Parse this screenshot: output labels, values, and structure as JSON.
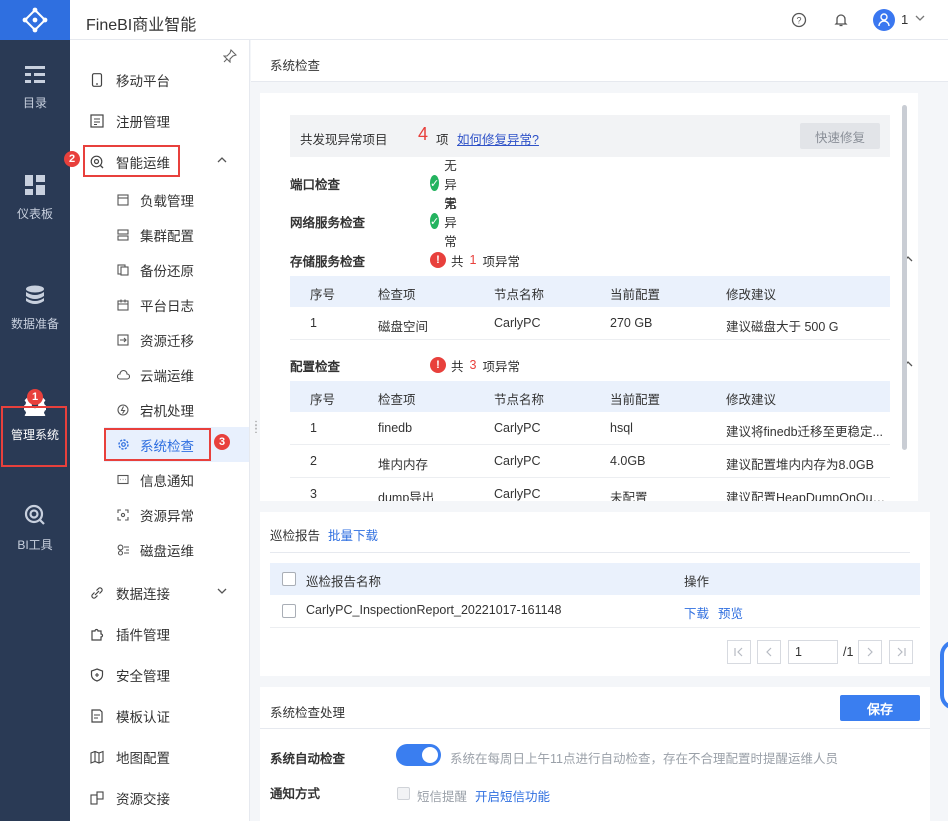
{
  "app": {
    "title": "FineBI商业智能",
    "user_num": "1"
  },
  "nav1": [
    {
      "label": "目录",
      "icon": "catalog-icon"
    },
    {
      "label": "仪表板",
      "icon": "dashboard-icon"
    },
    {
      "label": "数据准备",
      "icon": "database-icon"
    },
    {
      "label": "管理系统",
      "icon": "gear-icon",
      "active": true
    },
    {
      "label": "BI工具",
      "icon": "bi-tool-icon"
    }
  ],
  "nav2": {
    "items": [
      {
        "label": "移动平台"
      },
      {
        "label": "注册管理"
      },
      {
        "label": "智能运维"
      },
      {
        "label": "负载管理"
      },
      {
        "label": "集群配置"
      },
      {
        "label": "备份还原"
      },
      {
        "label": "平台日志"
      },
      {
        "label": "资源迁移"
      },
      {
        "label": "云端运维"
      },
      {
        "label": "宕机处理"
      },
      {
        "label": "系统检查"
      },
      {
        "label": "信息通知"
      },
      {
        "label": "资源异常"
      },
      {
        "label": "磁盘运维"
      },
      {
        "label": "数据连接"
      },
      {
        "label": "插件管理"
      },
      {
        "label": "安全管理"
      },
      {
        "label": "模板认证"
      },
      {
        "label": "地图配置"
      },
      {
        "label": "资源交接"
      }
    ]
  },
  "badges": {
    "b1": "1",
    "b2": "2",
    "b3": "3"
  },
  "page_title": "系统检查",
  "summary": {
    "prefix": "共发现异常项目",
    "count": "4",
    "suffix": "项",
    "link": "如何修复异常?",
    "quick_fix": "快速修复"
  },
  "checks": {
    "port": {
      "label": "端口检查",
      "status": "无异常"
    },
    "network": {
      "label": "网络服务检查",
      "status": "无异常"
    },
    "storage": {
      "label": "存储服务检查",
      "pre": "共",
      "count": "1",
      "post": "项异常"
    },
    "config": {
      "label": "配置检查",
      "pre": "共",
      "count": "3",
      "post": "项异常"
    }
  },
  "table_headers": [
    "序号",
    "检查项",
    "节点名称",
    "当前配置",
    "修改建议"
  ],
  "storage_rows": [
    [
      "1",
      "磁盘空间",
      "CarlyPC",
      "270 GB",
      "建议磁盘大于 500 G"
    ]
  ],
  "config_rows": [
    [
      "1",
      "finedb",
      "CarlyPC",
      "hsql",
      "建议将finedb迁移至更稳定..."
    ],
    [
      "2",
      "堆内内存",
      "CarlyPC",
      "4.0GB",
      "建议配置堆内内存为8.0GB"
    ],
    [
      "3",
      "dump导出",
      "CarlyPC",
      "未配置",
      "建议配置HeapDumpOnOut..."
    ]
  ],
  "report": {
    "title": "巡检报告",
    "batch_download": "批量下载",
    "col_name": "巡检报告名称",
    "col_op": "操作",
    "file_name": "CarlyPC_InspectionReport_20221017-161148",
    "download": "下载",
    "preview": "预览",
    "page_value": "1",
    "page_total": "/1"
  },
  "handling": {
    "title": "系统检查处理",
    "save": "保存",
    "auto_label": "系统自动检查",
    "auto_hint": "系统在每周日上午11点进行自动检查，存在不合理配置时提醒运维人员",
    "auto_on": true,
    "notify_label": "通知方式",
    "sms_label": "短信提醒",
    "sms_link": "开启短信功能"
  },
  "colors": {
    "accent": "#2f6fe0",
    "sidebar": "#2a3a55",
    "danger": "#e8403c",
    "success": "#24b35f"
  }
}
